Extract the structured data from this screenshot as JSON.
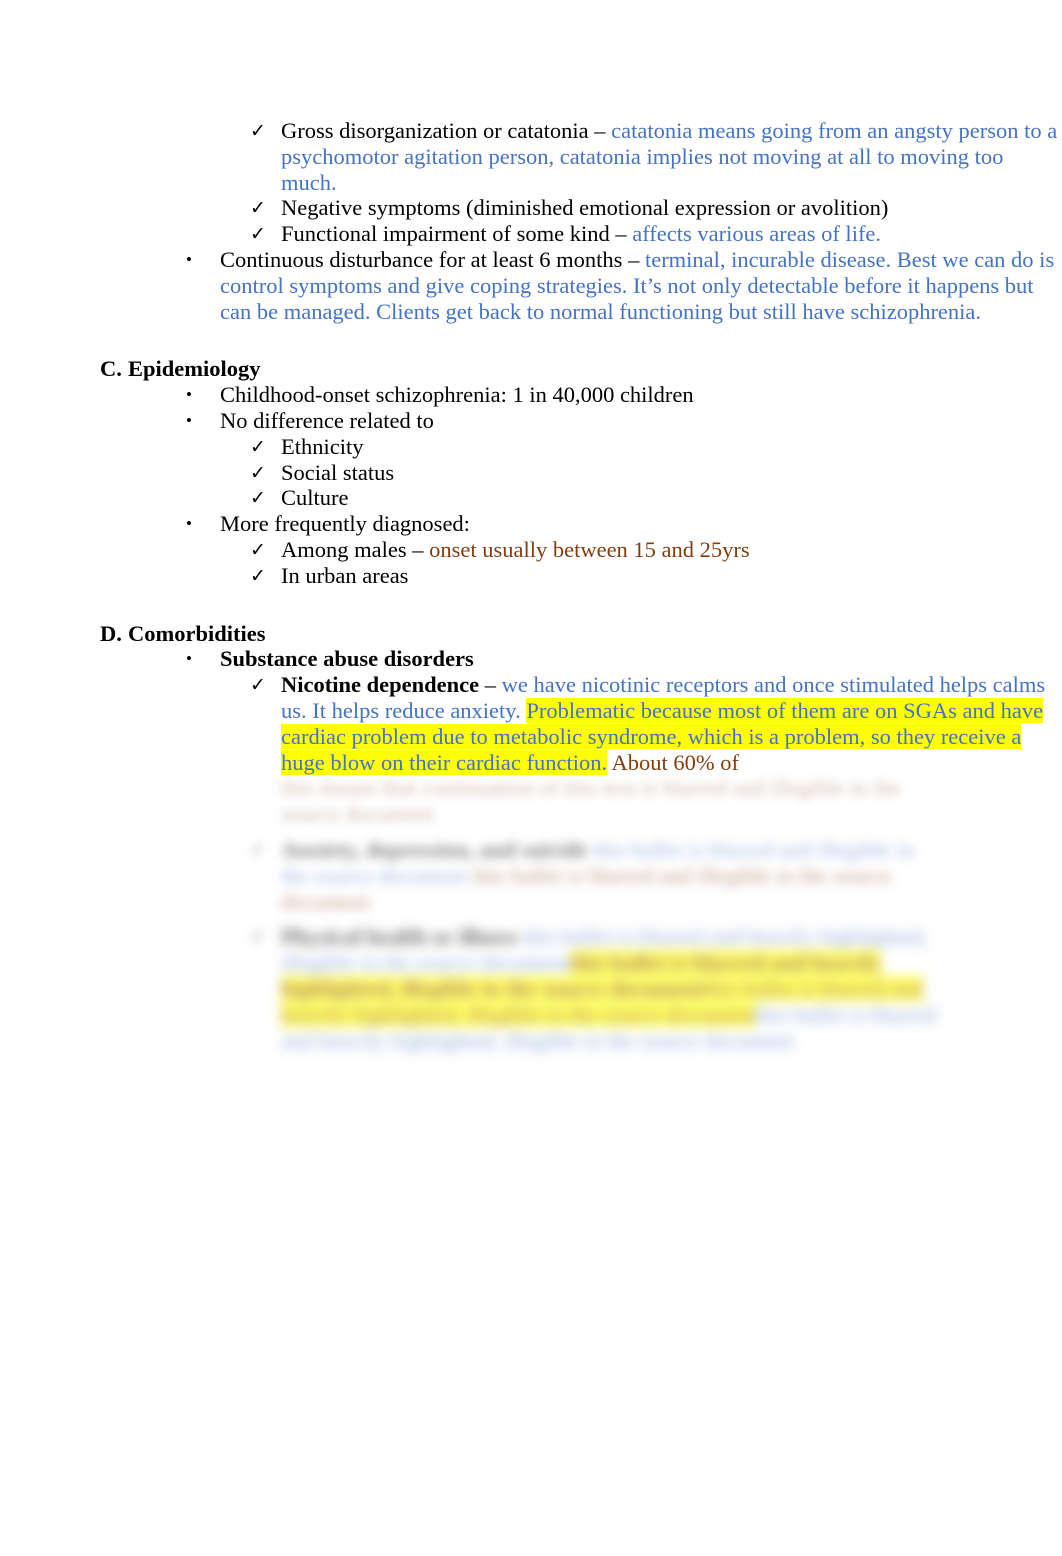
{
  "document": {
    "type": "lecture-notes",
    "topic": "Schizophrenia",
    "colors": {
      "body_text": "#000000",
      "annotation_blue": "#4472c4",
      "annotation_brown": "#843c0c",
      "highlight_yellow": "#ffff00"
    },
    "markers": {
      "bullet": "•",
      "check": "✓"
    }
  },
  "criteria": {
    "items": [
      {
        "lead": "Gross disorganization or catatonia – ",
        "note": "catatonia means going from an angsty person to a psychomotor agitation person, catatonia implies not moving at all to moving too much."
      },
      {
        "lead": "Negative symptoms (diminished emotional expression or avolition)",
        "note": ""
      },
      {
        "lead": "Functional impairment of some kind – ",
        "note": "affects various areas of life."
      }
    ],
    "continuous": {
      "lead": "Continuous disturbance for at least 6 months – ",
      "note": "terminal, incurable disease. Best we can do is control symptoms and give coping strategies. It’s not only detectable before it happens but can be managed. Clients get back to normal functioning but still have schizophrenia."
    }
  },
  "epidemiology": {
    "letter": "C.",
    "title": "Epidemiology",
    "bullets": [
      {
        "text": "Childhood-onset schizophrenia: 1 in 40,000 children"
      },
      {
        "text": "No difference related to"
      }
    ],
    "no_difference_items": [
      "Ethnicity",
      "Social status",
      "Culture"
    ],
    "more_frequent_label": "More frequently diagnosed:",
    "more_frequent_items": [
      {
        "lead": "Among males – ",
        "note": "onset usually between 15 and 25yrs"
      },
      {
        "lead": "In urban areas",
        "note": ""
      }
    ]
  },
  "comorbidities": {
    "letter": "D.",
    "title": "Comorbidities",
    "substance_abuse_label": "Substance abuse disorders",
    "nicotine": {
      "label": "Nicotine dependence",
      "dash": " – ",
      "note_plain_1": "we have nicotinic receptors and once stimulated helps calms us. It helps reduce anxiety. ",
      "note_highlighted": "Problematic because most of them are on SGAs and have cardiac problem due to metabolic syndrome, which is a problem, so they receive a huge blow on their cardiac function.",
      "note_brown_tail": " About 60% of",
      "obscured_continuation": "this means that continuation of this text is blurred and illegible in the source document"
    },
    "anxiety": {
      "label": "Anxiety, depression, and suicide",
      "obscured": "this bullet is blurred and illegible in the source document"
    },
    "physical": {
      "label": "Physical health or illness",
      "obscured": "this bullet is blurred and heavily highlighted, illegible in the source document"
    }
  }
}
